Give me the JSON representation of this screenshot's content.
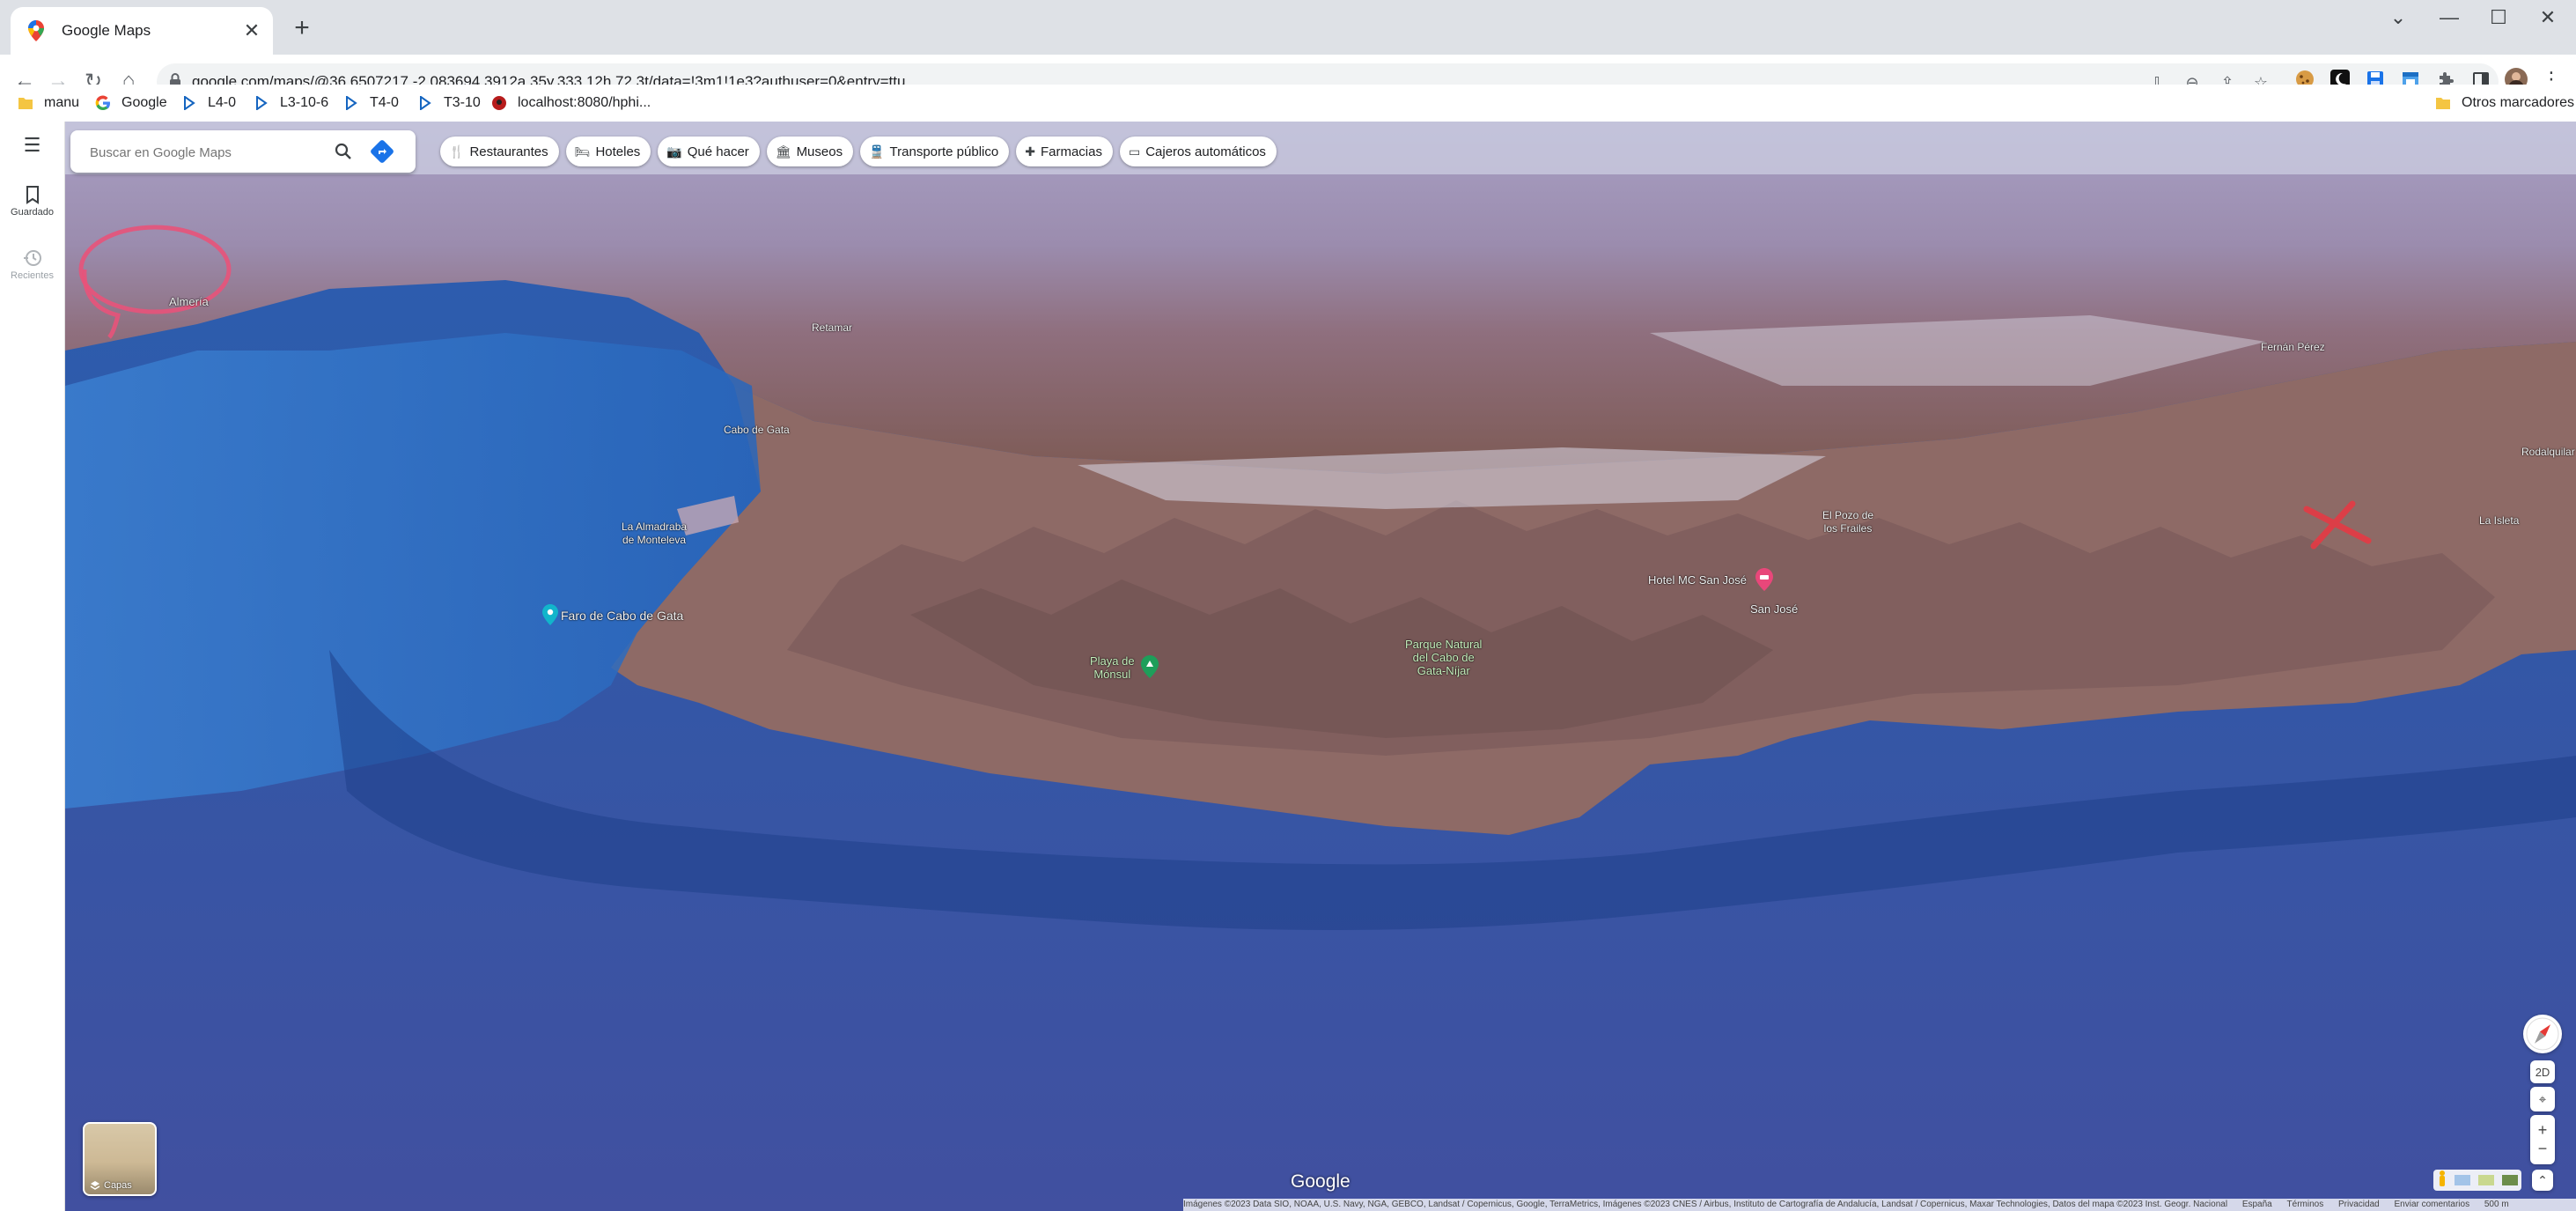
{
  "tab": {
    "title": "Google Maps",
    "close_glyph": "✕"
  },
  "new_tab_glyph": "+",
  "window_controls": {
    "collapse": "⌄",
    "minimize": "—",
    "maximize": "☐",
    "close": "✕"
  },
  "nav": {
    "back": "←",
    "forward": "→",
    "reload": "↻",
    "home": "⌂"
  },
  "omnibox": {
    "url": "google.com/maps/@36.6507217,-2.083694,3912a,35y,333.12h,72.3t/data=!3m1!1e3?authuser=0&entry=ttu"
  },
  "bookmarks": [
    {
      "label": "manu",
      "icon": "folder-icon"
    },
    {
      "label": "Google",
      "icon": "google-icon"
    },
    {
      "label": "L4-0",
      "icon": "bookmark-icon"
    },
    {
      "label": "L3-10-6",
      "icon": "bookmark-icon"
    },
    {
      "label": "T4-0",
      "icon": "bookmark-icon"
    },
    {
      "label": "T3-10",
      "icon": "bookmark-icon"
    },
    {
      "label": "localhost:8080/hphi...",
      "icon": "site-icon"
    }
  ],
  "other_bookmarks": "Otros marcadores",
  "rail": {
    "menu": "☰",
    "saved": "Guardado",
    "recent": "Recientes"
  },
  "search": {
    "placeholder": "Buscar en Google Maps"
  },
  "chips": [
    {
      "label": "Restaurantes",
      "icon": "restaurant-icon",
      "glyph": "🍴"
    },
    {
      "label": "Hoteles",
      "icon": "hotel-icon",
      "glyph": "🛏"
    },
    {
      "label": "Qué hacer",
      "icon": "camera-icon",
      "glyph": "📷"
    },
    {
      "label": "Museos",
      "icon": "museum-icon",
      "glyph": "🏛"
    },
    {
      "label": "Transporte público",
      "icon": "transit-icon",
      "glyph": "🚆"
    },
    {
      "label": "Farmacias",
      "icon": "pharmacy-icon",
      "glyph": "✚"
    },
    {
      "label": "Cajeros automáticos",
      "icon": "atm-icon",
      "glyph": "▭"
    }
  ],
  "map_labels": {
    "almeria": "Almería",
    "retamar": "Retamar",
    "cabo_de_gata": "Cabo de Gata",
    "almadraba": "La Almadraba\nde Monteleva",
    "faro": "Faro de Cabo de Gata",
    "playa_monsul": "Playa de\nMónsul",
    "parque_natural": "Parque Natural\ndel Cabo de\nGata-Níjar",
    "el_pozo": "El Pozo de\nlos Frailes",
    "hotel": "Hotel MC San José",
    "san_jose": "San José",
    "fernan_perez": "Fernán Pérez",
    "rodalquilar": "Rodalquilar",
    "la_isleta": "La Isleta"
  },
  "annotations": {
    "circle_color": "#e8537a",
    "cross_color": "#e53a44"
  },
  "map_controls": {
    "mode": "2D",
    "zoom_in": "+",
    "zoom_out": "−",
    "locate": "⌖",
    "expand": "⌃"
  },
  "layers": {
    "label": "Capas"
  },
  "google_logo": "Google",
  "attribution": "Imágenes ©2023 Data SIO, NOAA, U.S. Navy, NGA, GEBCO, Landsat / Copernicus, Google, TerraMetrics, Imágenes ©2023 CNES / Airbus, Instituto de Cartografía de Andalucía, Landsat / Copernicus, Maxar Technologies, Datos del mapa ©2023 Inst. Geogr. Nacional",
  "footer_links": [
    "España",
    "Términos",
    "Privacidad",
    "Enviar comentarios"
  ],
  "scale": "500 m"
}
